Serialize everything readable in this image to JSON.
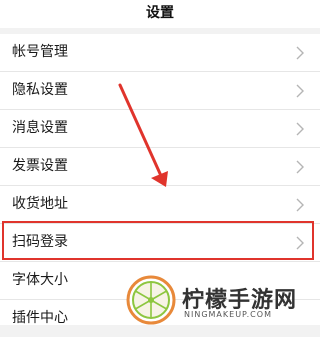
{
  "header": {
    "title": "设置"
  },
  "settings_items": [
    {
      "label": "帐号管理"
    },
    {
      "label": "隐私设置"
    },
    {
      "label": "消息设置"
    },
    {
      "label": "发票设置"
    },
    {
      "label": "收货地址"
    },
    {
      "label": "扫码登录"
    },
    {
      "label": "字体大小"
    },
    {
      "label": "插件中心"
    }
  ],
  "watermark": {
    "name": "柠檬手游网",
    "url": "NINGMAKEUP.COM"
  },
  "colors": {
    "highlight": "#e0342c",
    "background": "#f2f2f2"
  },
  "icons": {
    "chevron": "chevron-right-icon",
    "annotation": "red-arrow-annotation",
    "logo": "lemon-slice-logo"
  }
}
